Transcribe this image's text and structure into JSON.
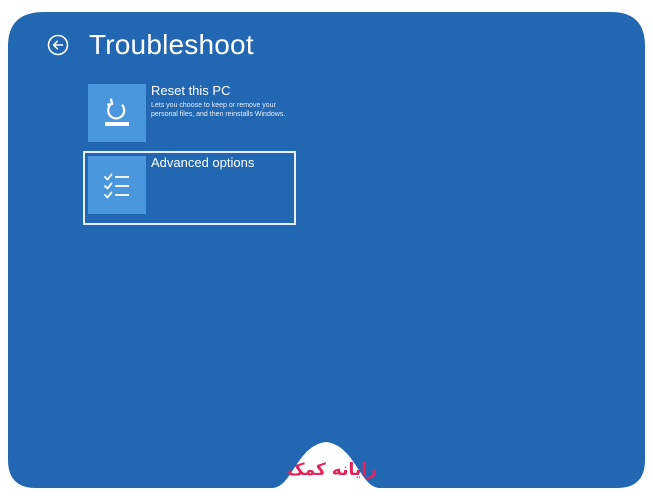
{
  "page": {
    "title": "Troubleshoot",
    "back_icon": "back-arrow-circle-icon"
  },
  "options": [
    {
      "id": "reset",
      "icon": "reset-pc-icon",
      "title": "Reset this PC",
      "description": "Lets you choose to keep or remove your personal files, and then reinstalls Windows."
    },
    {
      "id": "advanced",
      "icon": "checklist-icon",
      "title": "Advanced options",
      "description": ""
    }
  ],
  "watermark": {
    "text": "رایانه کمک"
  },
  "colors": {
    "background": "#2167b2",
    "tile": "#4a97dd",
    "text": "#ffffff",
    "watermark": "#e3245a"
  }
}
